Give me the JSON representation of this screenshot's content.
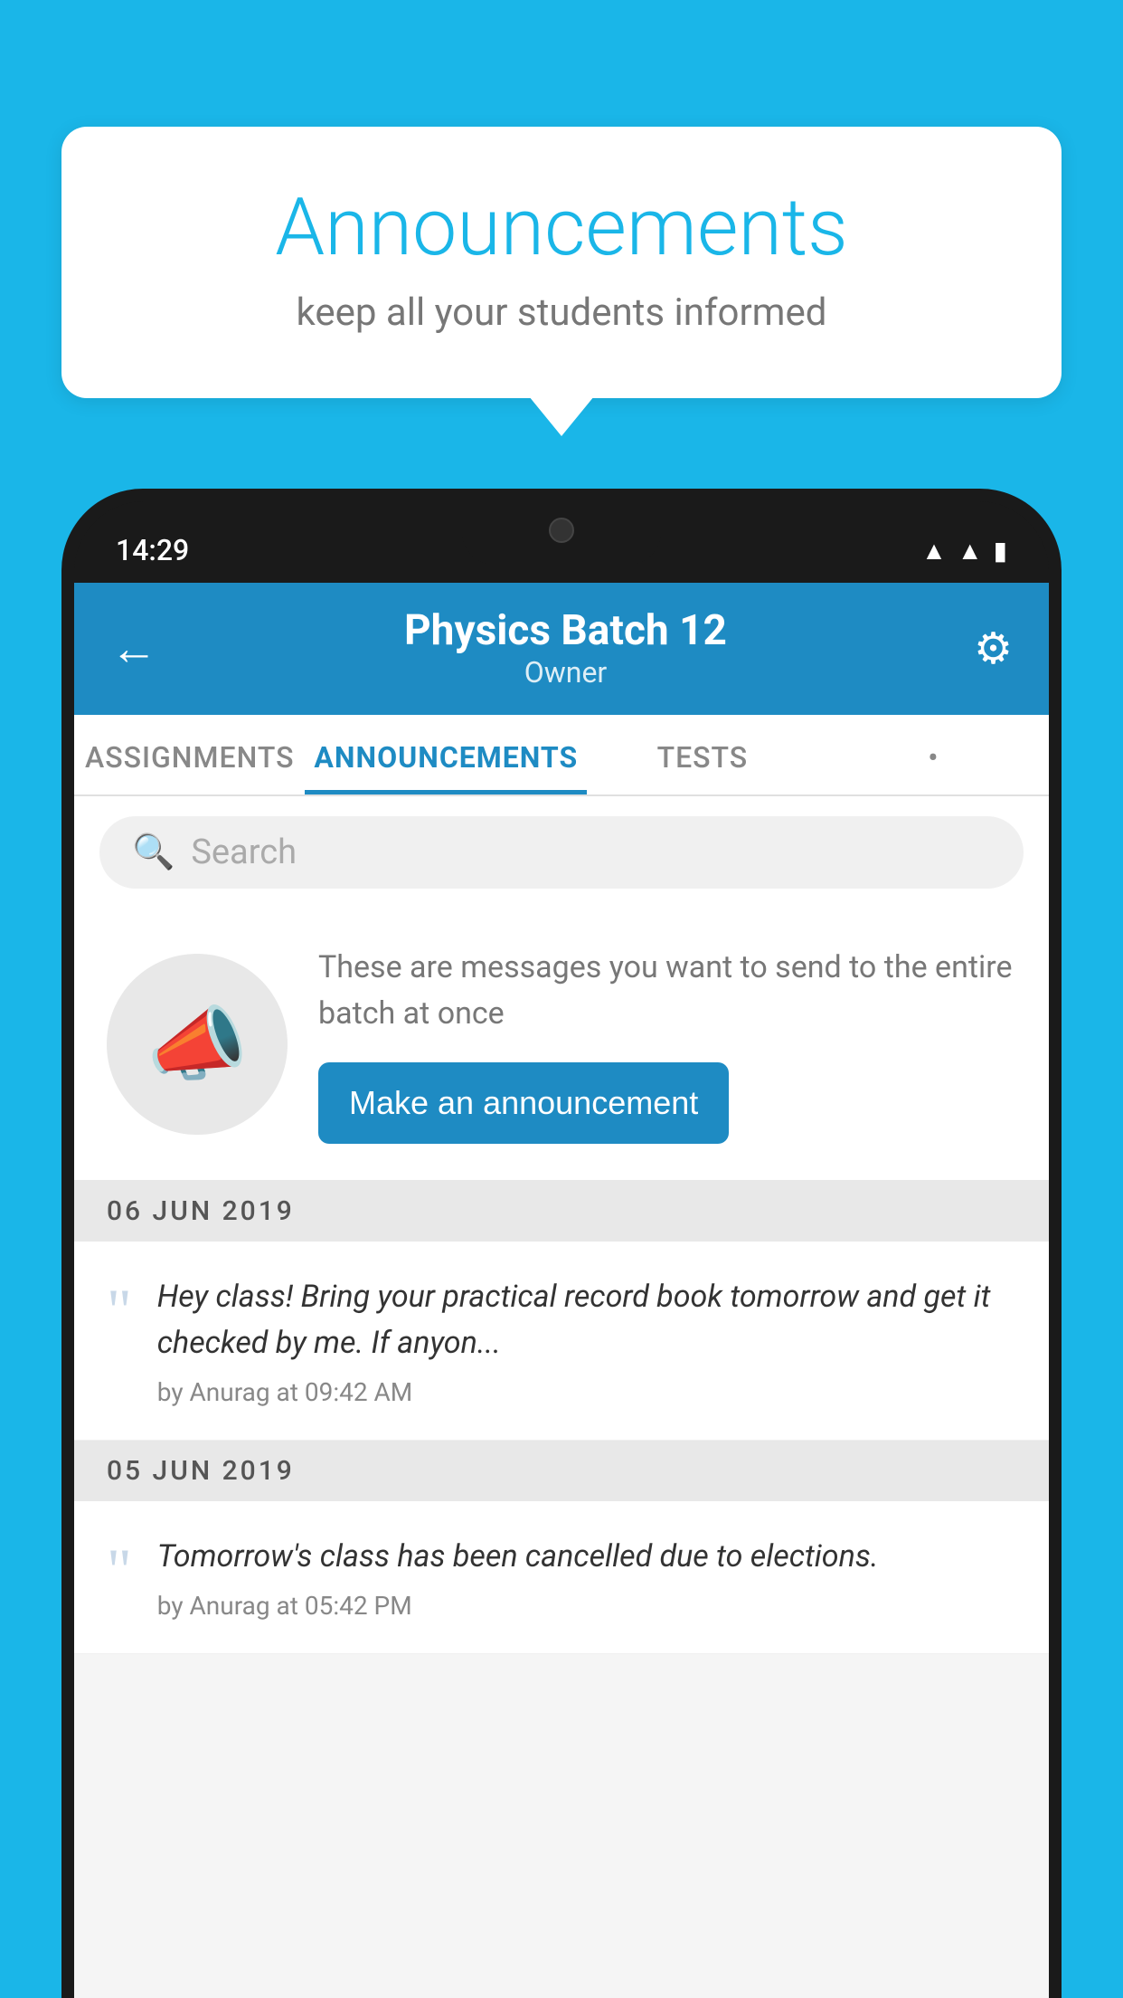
{
  "background_color": "#1ab6e8",
  "speech_bubble": {
    "title": "Announcements",
    "subtitle": "keep all your students informed"
  },
  "phone": {
    "status_bar": {
      "time": "14:29"
    },
    "header": {
      "title": "Physics Batch 12",
      "subtitle": "Owner",
      "back_label": "←",
      "gear_label": "⚙"
    },
    "tabs": [
      {
        "label": "ASSIGNMENTS",
        "active": false
      },
      {
        "label": "ANNOUNCEMENTS",
        "active": true
      },
      {
        "label": "TESTS",
        "active": false
      },
      {
        "label": "•",
        "active": false
      }
    ],
    "search": {
      "placeholder": "Search"
    },
    "promo": {
      "description": "These are messages you want to send to the entire batch at once",
      "button_label": "Make an announcement"
    },
    "announcements": [
      {
        "date": "06  JUN  2019",
        "items": [
          {
            "text": "Hey class! Bring your practical record book tomorrow and get it checked by me. If anyon...",
            "meta": "by Anurag at 09:42 AM"
          }
        ]
      },
      {
        "date": "05  JUN  2019",
        "items": [
          {
            "text": "Tomorrow's class has been cancelled due to elections.",
            "meta": "by Anurag at 05:42 PM"
          }
        ]
      }
    ]
  }
}
